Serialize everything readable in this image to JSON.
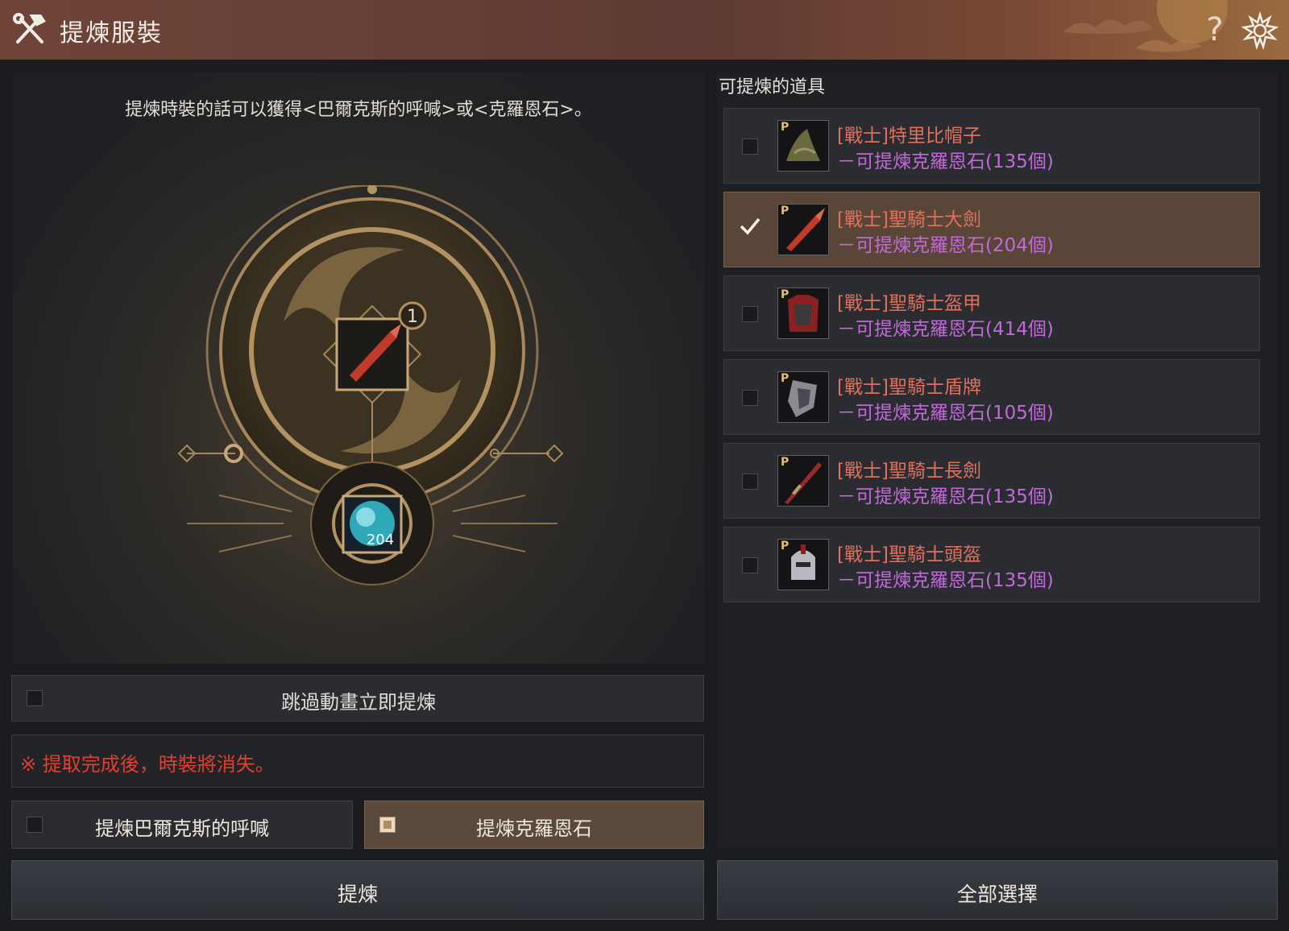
{
  "window": {
    "title": "提煉服裝",
    "help_label": "?",
    "title_icon": "hammer-wrench-icon",
    "settings_icon": "gear-icon"
  },
  "left": {
    "description": "提煉時裝的話可以獲得<巴爾克斯的呼喊>或<克羅恩石>。",
    "slot_count": "1",
    "result_count": "204",
    "skip_animation_label": "跳過動畫立即提煉",
    "warning": "※ 提取完成後，時裝將消失。",
    "option_a_label": "提煉巴爾克斯的呼喊",
    "option_b_label": "提煉克羅恩石",
    "option_b_checked": true,
    "skip_checked": false,
    "refine_button": "提煉"
  },
  "right": {
    "header": "可提煉的道具",
    "select_all_button": "全部選擇",
    "items": [
      {
        "name": "[戰士]特里比帽子",
        "sub": "－可提煉克羅恩石(135個)",
        "checked": false,
        "icon": "hat-icon"
      },
      {
        "name": "[戰士]聖騎士大劍",
        "sub": "－可提煉克羅恩石(204個)",
        "checked": true,
        "icon": "greatsword-icon"
      },
      {
        "name": "[戰士]聖騎士盔甲",
        "sub": "－可提煉克羅恩石(414個)",
        "checked": false,
        "icon": "armor-icon"
      },
      {
        "name": "[戰士]聖騎士盾牌",
        "sub": "－可提煉克羅恩石(105個)",
        "checked": false,
        "icon": "shield-icon"
      },
      {
        "name": "[戰士]聖騎士長劍",
        "sub": "－可提煉克羅恩石(135個)",
        "checked": false,
        "icon": "longsword-icon"
      },
      {
        "name": "[戰士]聖騎士頭盔",
        "sub": "－可提煉克羅恩石(135個)",
        "checked": false,
        "icon": "helmet-icon"
      }
    ]
  },
  "colors": {
    "item_name": "#e0705a",
    "item_sub": "#c06ad8",
    "warning": "#e0402f",
    "selected_bg": "#5a4638"
  }
}
